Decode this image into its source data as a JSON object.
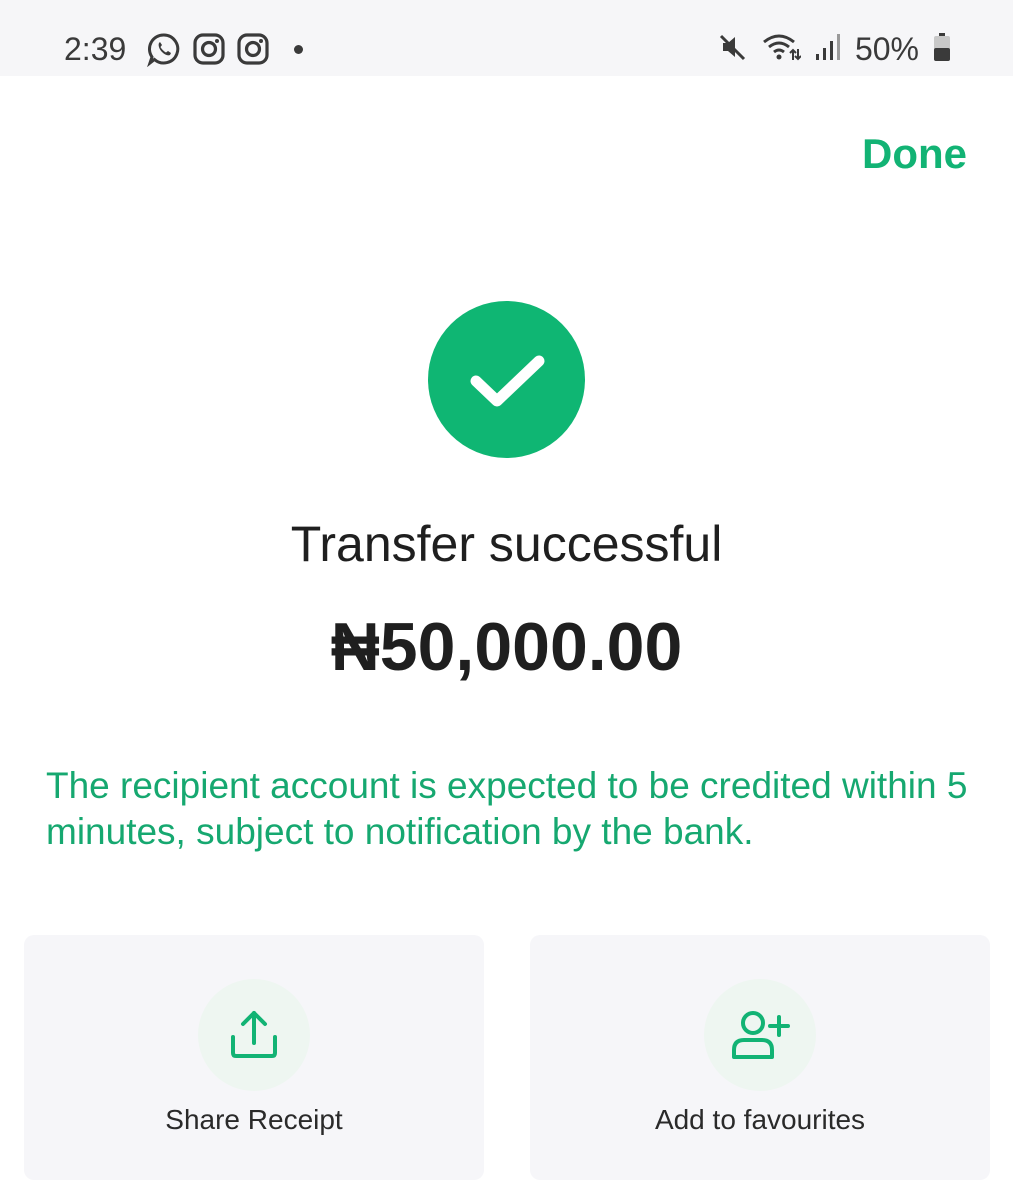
{
  "status_bar": {
    "time": "2:39",
    "battery": "50%",
    "icons": [
      "whatsapp-icon",
      "instagram-icon",
      "instagram-icon",
      "notification-dot",
      "mute-icon",
      "wifi-icon",
      "signal-icon",
      "battery-icon"
    ]
  },
  "header": {
    "done_label": "Done"
  },
  "result": {
    "title": "Transfer successful",
    "amount": "₦50,000.00",
    "notice": "The recipient account is expected to be credited within 5 minutes, subject to notification by the bank.",
    "icon": "checkmark-icon"
  },
  "actions": [
    {
      "label": "Share Receipt",
      "icon": "share-upload-icon"
    },
    {
      "label": "Add to favourites",
      "icon": "add-user-icon"
    }
  ],
  "colors": {
    "accent": "#12b374",
    "success_circle": "#0fb673",
    "card_bg": "#f6f6f9",
    "status_bar_bg": "#f6f6f8"
  }
}
